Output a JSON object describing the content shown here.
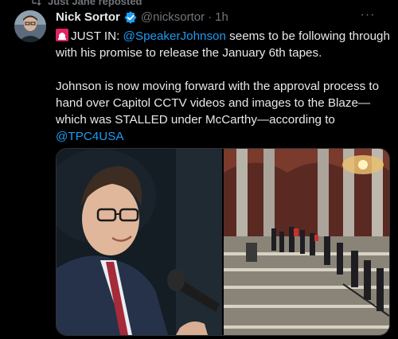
{
  "social_context": {
    "text": "Just Jane reposted",
    "icon": "repost-icon"
  },
  "author": {
    "display_name": "Nick Sortor",
    "handle": "@nicksortor",
    "separator": "·",
    "time": "1h",
    "verified_icon": "verified-badge-icon",
    "avatar_icon": "avatar"
  },
  "more_label": "···",
  "tweet": {
    "siren_icon": "rotating-light-icon",
    "intro": "JUST IN: ",
    "mention1": "@SpeakerJohnson",
    "line1_rest": " seems to be following through with his promise to release the January 6th tapes.",
    "para2": "Johnson is now moving forward with the approval process to hand over Capitol CCTV videos and images to the Blaze—which was STALLED under McCarthy—according to ",
    "mention2": "@TPC4USA"
  },
  "colors": {
    "background": "#000000",
    "text": "#e7e9ea",
    "secondary": "#71767b",
    "link": "#1d9bf0",
    "verified": "#1d9bf0"
  }
}
